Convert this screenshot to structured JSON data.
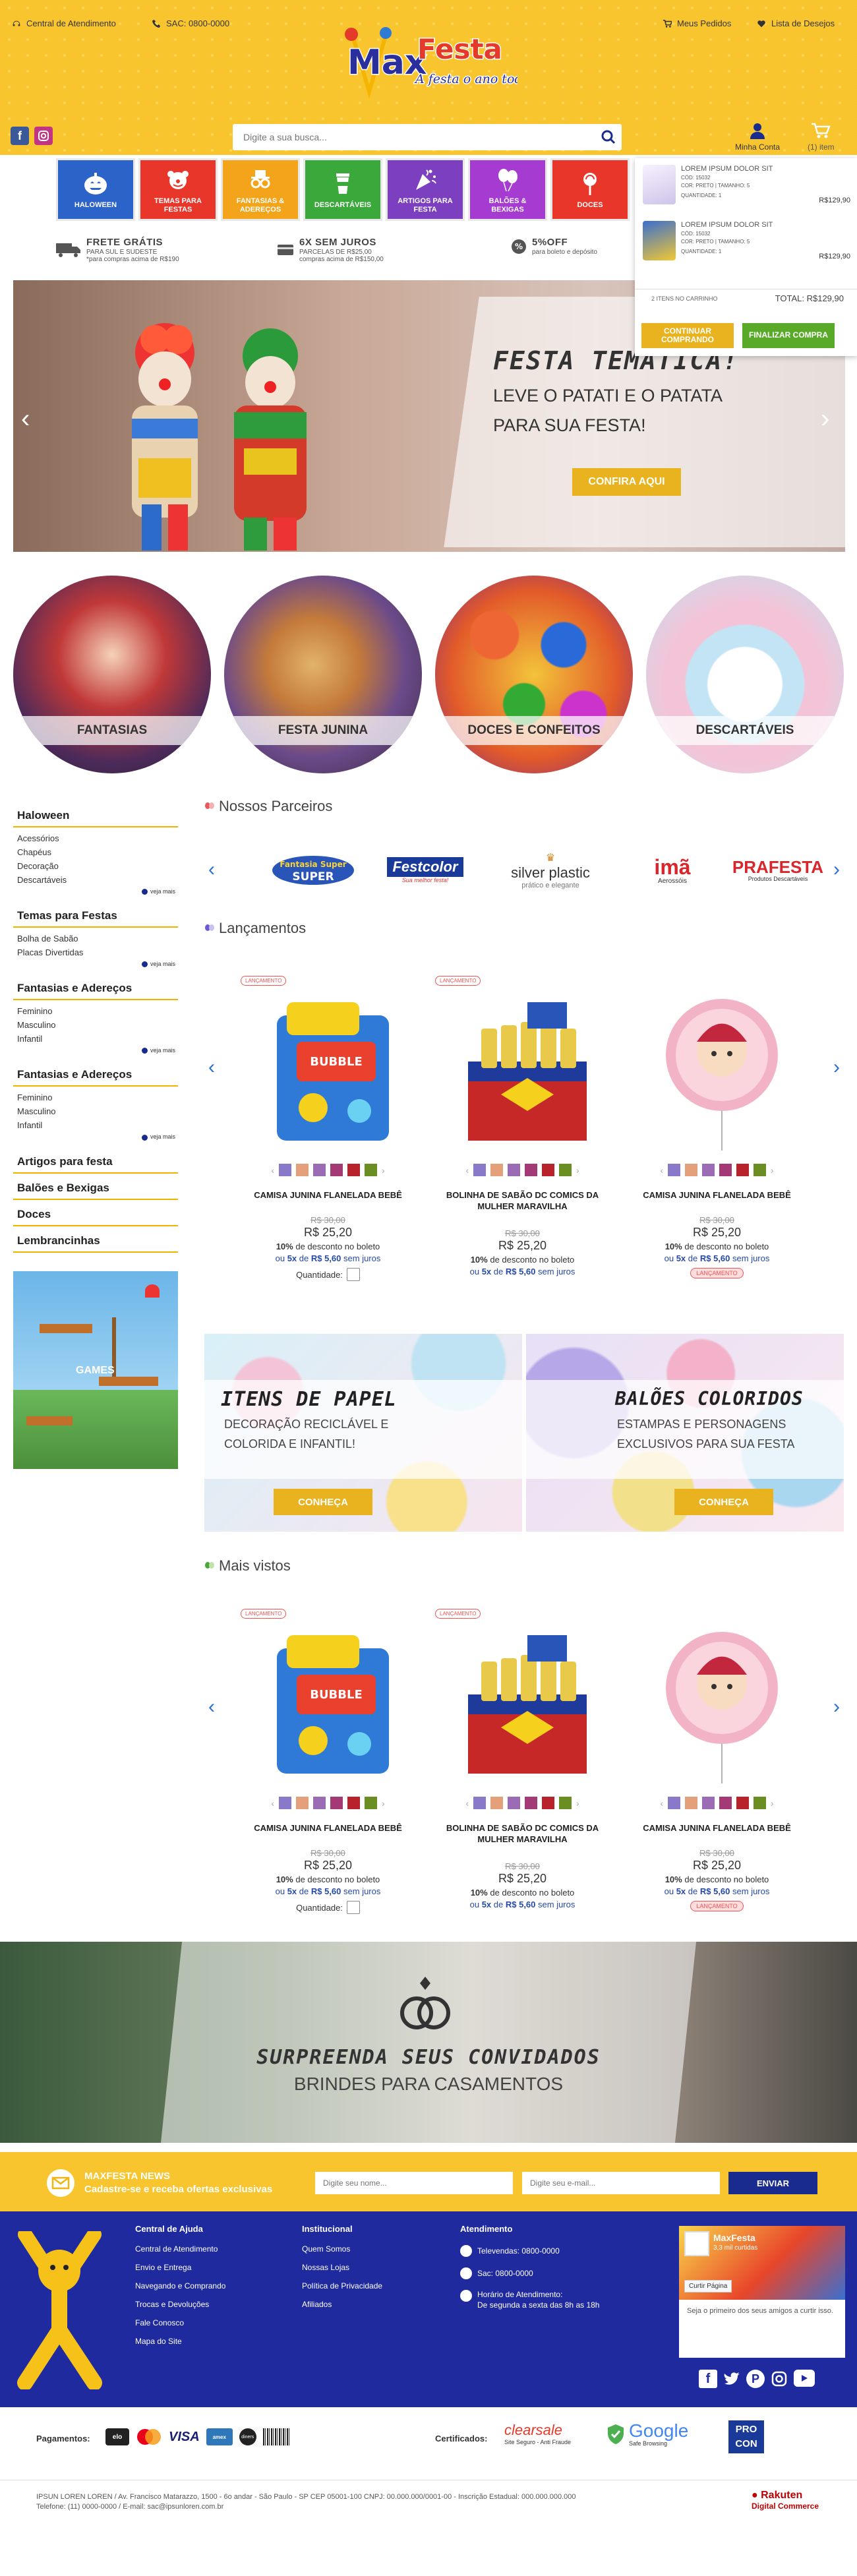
{
  "topbar": {
    "central_label": "Central de Atendimento",
    "sac_label": "SAC: 0800-0000",
    "orders_label": "Meus Pedidos",
    "wishlist_label": "Lista de Desejos"
  },
  "logo": {
    "brand": "MaxFesta",
    "tagline": "A festa o ano todo!"
  },
  "search": {
    "placeholder": "Digite a sua busca..."
  },
  "account": {
    "label": "Minha Conta",
    "cart_count": "(1) item"
  },
  "nav": [
    {
      "label": "HALOWEEN",
      "color": "#2b63c9",
      "icon": "pumpkin-icon"
    },
    {
      "label": "TEMAS PARA FESTAS",
      "color": "#e8362b",
      "icon": "clown-icon"
    },
    {
      "label": "FANTASIAS & ADEREÇOS",
      "color": "#f3a41a",
      "icon": "glasses-icon"
    },
    {
      "label": "DESCARTÁVEIS",
      "color": "#3aa83a",
      "icon": "cup-icon"
    },
    {
      "label": "ARTIGOS PARA FESTA",
      "color": "#7b3fbf",
      "icon": "party-icon"
    },
    {
      "label": "BALÕES & BEXIGAS",
      "color": "#a63bd1",
      "icon": "balloon-icon"
    },
    {
      "label": "DOCES",
      "color": "#e8362b",
      "icon": "candy-icon"
    }
  ],
  "perks": [
    {
      "title": "FRETE GRÁTIS",
      "line1": "PARA SUL E SUDESTE",
      "line2": "*para compras acima de R$190"
    },
    {
      "title": "6X SEM JUROS",
      "line1": "PARCELAS DE R$25,00",
      "line2": "compras acima de R$150,00"
    },
    {
      "title": "5%OFF",
      "line1": "para boleto e depósito",
      "line2": ""
    }
  ],
  "cart": {
    "items": [
      {
        "title": "LOREM IPSUM DOLOR SIT",
        "code": "CÓD: 15032",
        "color": "COR: PRETO | TAMANHO: 5",
        "qty": "QUANTIDADE: 1",
        "price": "R$129,90"
      },
      {
        "title": "LOREM IPSUM DOLOR SIT",
        "code": "CÓD: 15032",
        "color": "COR: PRETO | TAMANHO: 5",
        "qty": "QUANTIDADE: 1",
        "price": "R$129,90"
      }
    ],
    "count_label": "2 ITENS NO CARRINHO",
    "total_label": "TOTAL: R$129,90",
    "continue_label": "CONTINUAR COMPRANDO",
    "checkout_label": "FINALIZAR COMPRA"
  },
  "hero": {
    "title": "FESTA TEMÁTICA!",
    "line1": "LEVE O PATATI E O PATATA",
    "line2": "PARA SUA FESTA!",
    "button": "CONFIRA AQUI"
  },
  "categories": [
    "FANTASIAS",
    "FESTA JUNINA",
    "DOCES E CONFEITOS",
    "DESCARTÁVEIS"
  ],
  "sidebar": {
    "groups": [
      {
        "title": "Haloween",
        "items": [
          "Acessórios",
          "Chapéus",
          "Decoração",
          "Descartáveis"
        ],
        "more": "veja mais"
      },
      {
        "title": "Temas para Festas",
        "items": [
          "Bolha de Sabão",
          "Placas Divertidas"
        ],
        "more": "veja mais"
      },
      {
        "title": "Fantasias e Adereços",
        "items": [
          "Feminino",
          "Masculino",
          "Infantil"
        ],
        "more": "veja mais"
      },
      {
        "title": "Fantasias e Adereços",
        "items": [
          "Feminino",
          "Masculino",
          "Infantil"
        ],
        "more": "veja mais"
      }
    ],
    "links": [
      "Artigos para festa",
      "Balões e Bexigas",
      "Doces",
      "Lembrancinhas"
    ],
    "games_label": "GAMES"
  },
  "partners": {
    "title": "Nossos Parceiros",
    "logos": [
      {
        "name": "Fantasia Super",
        "sub": ""
      },
      {
        "name": "Festcolor",
        "sub": "Sua melhor festa!"
      },
      {
        "name": "silver plastic",
        "sub": "prático e elegante"
      },
      {
        "name": "imã",
        "sub": "Aerossóis"
      },
      {
        "name": "PRAFESTA",
        "sub": "Produtos Descartáveis"
      }
    ]
  },
  "launches": {
    "title": "Lançamentos"
  },
  "most_viewed": {
    "title": "Mais vistos"
  },
  "products": [
    {
      "badge": "LANÇAMENTO",
      "name": "CAMISA JUNINA FLANELADA BEBÊ",
      "old": "R$ 30,00",
      "price": "R$ 25,20",
      "disc_pct": "10%",
      "disc_text": " de desconto no boleto",
      "inst_pre": "ou ",
      "inst_n": "5x",
      "inst_mid": " de ",
      "inst_val": "R$ 5,60",
      "inst_post": " sem juros",
      "qty_label": "Quantidade:",
      "unavailable": ""
    },
    {
      "badge": "LANÇAMENTO",
      "name": "BOLINHA DE SABÃO DC COMICS DA MULHER MARAVILHA",
      "old": "R$ 30,00",
      "price": "R$ 25,20",
      "disc_pct": "10%",
      "disc_text": " de desconto no boleto",
      "inst_pre": "ou ",
      "inst_n": "5x",
      "inst_mid": " de ",
      "inst_val": "R$ 5,60",
      "inst_post": " sem juros",
      "qty_label": "",
      "unavailable": ""
    },
    {
      "badge": "",
      "name": "CAMISA JUNINA FLANELADA BEBÊ",
      "old": "R$ 30,00",
      "price": "R$ 25,20",
      "disc_pct": "10%",
      "disc_text": " de desconto no boleto",
      "inst_pre": "ou ",
      "inst_n": "5x",
      "inst_mid": " de ",
      "inst_val": "R$ 5,60",
      "inst_post": " sem juros",
      "qty_label": "",
      "unavailable": "LANÇAMENTO"
    }
  ],
  "swatch_colors": [
    "#8a78c9",
    "#e3a07a",
    "#9b6bb5",
    "#a33a75",
    "#b8222a",
    "#6b8e23"
  ],
  "banner_paper": {
    "title": "ITENS DE PAPEL",
    "line1": "DECORAÇÃO RECICLÁVEL E",
    "line2": "COLORIDA E INFANTIL!",
    "button": "CONHEÇA"
  },
  "banner_balloons": {
    "title": "BALÕES COLORIDOS",
    "line1": "ESTAMPAS E PERSONAGENS",
    "line2": "EXCLUSIVOS PARA SUA FESTA",
    "button": "CONHEÇA"
  },
  "wedding": {
    "title": "SURPREENDA SEUS CONVIDADOS",
    "subtitle": "BRINDES PARA CASAMENTOS"
  },
  "newsletter": {
    "title": "MAXFESTA NEWS",
    "subtitle": "Cadastre-se e receba ofertas exclusivas",
    "name_placeholder": "Digite seu nome...",
    "email_placeholder": "Digite seu e-mail...",
    "button": "ENVIAR"
  },
  "footer": {
    "help_title": "Central de Ajuda",
    "help_links": [
      "Central de Atendimento",
      "Envio e Entrega",
      "Navegando e Comprando",
      "Trocas e Devoluções",
      "Fale Conosco",
      "Mapa do Site"
    ],
    "inst_title": "Institucional",
    "inst_links": [
      "Quem Somos",
      "Nossas Lojas",
      "Política de Privacidade",
      "Afiliados"
    ],
    "att_title": "Atendimento",
    "att_phone": "Televendas: 0800-0000",
    "att_sac": "Sac: 0800-0000",
    "att_hours_title": "Horário de Atendimento:",
    "att_hours": "De segunda a sexta das 8h as 18h",
    "fb_page": "MaxFesta",
    "fb_likes": "3,3 mil curtidas",
    "fb_like_btn": "Curtir Página",
    "fb_text": "Seja o primeiro dos seus amigos a curtir isso."
  },
  "payments": {
    "label": "Pagamentos:",
    "cards": [
      "elo",
      "mastercard",
      "VISA",
      "amex",
      "diners",
      "boleto"
    ]
  },
  "certs": {
    "label": "Certificados:",
    "clearsale": "clearsale",
    "clearsale_sub": "Site Seguro - Anti Fraude",
    "google": "Google",
    "google_sub": "Safe Browsing",
    "procon": "PRO CON"
  },
  "legal": {
    "line1": "IPSUN LOREN LOREN / Av. Francisco Matarazzo, 1500 - 6o andar - São Paulo - SP   CEP 05001-100  CNPJ: 00.000.000/0001-00  - Inscrição Estadual: 000.000.000.000",
    "line2": "Telefone: (11) 0000-0000 / E-mail: sac@ipsunloren.com.br",
    "rakuten": "Rakuten",
    "rakuten_sub": "Digital Commerce"
  }
}
